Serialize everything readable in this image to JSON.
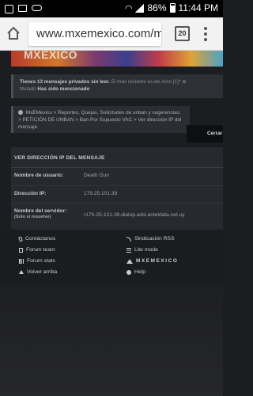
{
  "status_bar": {
    "battery": "86%",
    "time": "11:44 PM"
  },
  "browser": {
    "url": "www.mxemexico.com/modе",
    "tab_count": "20"
  },
  "banner": {
    "logo_text": "MXEXICO"
  },
  "notice": {
    "prefix": "Tienes 13 mensajes privados sin leer.",
    "middle": "El más reciente es de Aron [1]*",
    "title_prefix": "titulado",
    "title": "Has sido mencionado"
  },
  "breadcrumb": {
    "items": [
      "MxEMexico",
      "Reportes, Quejas, Solicitudes de unban y sugerencias.",
      "PETICIÓN DE UNBAN",
      "Ban Por Supuesto VAC",
      "Ver dirección IP del mensaje"
    ],
    "separator": ">"
  },
  "close_button": {
    "label": "Cerrar"
  },
  "panel": {
    "title": "VER DIRECCIÓN IP DEL MENSAJE",
    "rows": [
      {
        "label": "Nombre de usuario:",
        "value": "Death Gun"
      },
      {
        "label": "Dirección IP:",
        "value": "179.25.101.39"
      },
      {
        "label": "Nombre del servidor:",
        "sublabel": "(Solo si resuelve)",
        "value": "r179-25-101-39.dialup.adsl.anteldata.net.uy"
      }
    ]
  },
  "footer": {
    "left": [
      "Contáctanos",
      "Forum team",
      "Forum stats",
      "Volver arriba"
    ],
    "right": [
      "Sindicación RSS",
      "Lite mode",
      "MXEMEXICO",
      "Help"
    ]
  }
}
